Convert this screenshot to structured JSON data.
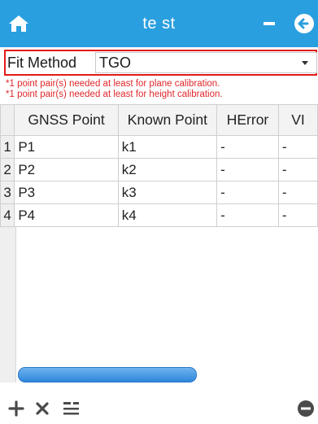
{
  "header": {
    "title": "te st",
    "icons": {
      "home": "home-icon",
      "minimize": "minimize-icon",
      "back": "back-arrow-icon"
    }
  },
  "fit_method": {
    "label": "Fit Method",
    "value": "TGO"
  },
  "warnings": [
    "*1 point pair(s) needed at least for plane calibration.",
    "*1 point pair(s) needed at least for height calibration."
  ],
  "table": {
    "columns": [
      "GNSS Point",
      "Known Point",
      "HError",
      "VI"
    ],
    "rows": [
      {
        "num": "1",
        "gnss": "P1",
        "known": "k1",
        "herror": "-",
        "verror": "-"
      },
      {
        "num": "2",
        "gnss": "P2",
        "known": "k2",
        "herror": "-",
        "verror": "-"
      },
      {
        "num": "3",
        "gnss": "P3",
        "known": "k3",
        "herror": "-",
        "verror": "-"
      },
      {
        "num": "4",
        "gnss": "P4",
        "known": "k4",
        "herror": "-",
        "verror": "-"
      }
    ]
  },
  "toolbar": {
    "icons": [
      "add-icon",
      "delete-icon",
      "list-icon",
      "more-icon"
    ]
  },
  "colors": {
    "accent": "#2a9fdf",
    "warning": "#e0272b",
    "highlight_border": "#e21a1a"
  }
}
